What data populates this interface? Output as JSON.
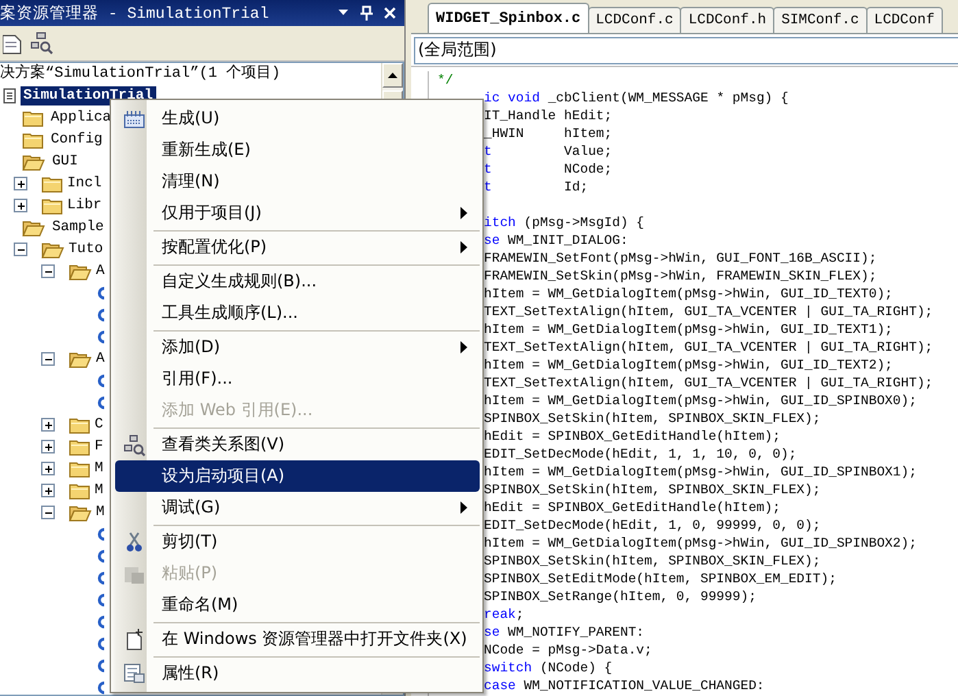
{
  "solution_explorer": {
    "title": "案资源管理器 - SimulationTrial",
    "solution_label": "决方案“SimulationTrial”(1 个项目)",
    "tree": [
      {
        "label": "SimulationTrial",
        "kind": "project",
        "selected": true,
        "children": [
          {
            "label": "Applica",
            "kind": "folder",
            "selected": false
          },
          {
            "label": "Config",
            "kind": "folder",
            "selected": false
          },
          {
            "label": "GUI",
            "kind": "folder",
            "selected": false,
            "expanded": true,
            "children": [
              {
                "label": "Incl",
                "kind": "folder",
                "selected": false,
                "expanded": false
              },
              {
                "label": "Libr",
                "kind": "folder",
                "selected": false,
                "expanded": false
              }
            ]
          },
          {
            "label": "Sample",
            "kind": "folder",
            "selected": false,
            "expanded": true,
            "children": [
              {
                "label": "Tuto",
                "kind": "folder",
                "selected": false,
                "expanded": true,
                "children": [
                  {
                    "label": "A",
                    "kind": "folder",
                    "selected": false,
                    "expanded": true,
                    "children": [
                      {
                        "kind": "file"
                      },
                      {
                        "kind": "file"
                      },
                      {
                        "kind": "file"
                      }
                    ]
                  },
                  {
                    "label": "A",
                    "kind": "folder",
                    "selected": false,
                    "expanded": true,
                    "children": [
                      {
                        "kind": "file"
                      },
                      {
                        "kind": "file"
                      }
                    ]
                  },
                  {
                    "label": "C",
                    "kind": "folder",
                    "selected": false,
                    "expanded": false
                  },
                  {
                    "label": "F",
                    "kind": "folder",
                    "selected": false,
                    "expanded": false
                  },
                  {
                    "label": "M",
                    "kind": "folder",
                    "selected": false,
                    "expanded": false
                  },
                  {
                    "label": "M",
                    "kind": "folder",
                    "selected": false,
                    "expanded": false
                  },
                  {
                    "label": "M",
                    "kind": "folder",
                    "selected": false,
                    "expanded": true,
                    "children": [
                      {
                        "kind": "file"
                      },
                      {
                        "kind": "file"
                      },
                      {
                        "kind": "file"
                      },
                      {
                        "kind": "file"
                      },
                      {
                        "kind": "file"
                      },
                      {
                        "kind": "file"
                      },
                      {
                        "kind": "file"
                      },
                      {
                        "kind": "file"
                      }
                    ]
                  }
                ]
              }
            ]
          }
        ]
      }
    ]
  },
  "editor": {
    "tabs": [
      {
        "label": "WIDGET_Spinbox.c",
        "selected": true
      },
      {
        "label": "LCDConf.c",
        "selected": false
      },
      {
        "label": "LCDConf.h",
        "selected": false
      },
      {
        "label": "SIMConf.c",
        "selected": false
      },
      {
        "label": "LCDConf",
        "selected": false
      }
    ],
    "scope": "(全局范围)",
    "lines": [
      {
        "kind": "comment",
        "text": "*/"
      },
      {
        "kind": "code",
        "kw": "ic void",
        "text": " _cbClient(WM_MESSAGE * pMsg) {"
      },
      {
        "kind": "code",
        "text": "IT_Handle hEdit;"
      },
      {
        "kind": "code",
        "text": "_HWIN     hItem;"
      },
      {
        "kind": "code",
        "kw": "t",
        "text": "         Value;"
      },
      {
        "kind": "code",
        "kw": "t",
        "text": "         NCode;"
      },
      {
        "kind": "code",
        "kw": "t",
        "text": "         Id;"
      },
      {
        "kind": "blank"
      },
      {
        "kind": "code",
        "kw": "itch",
        "text": " (pMsg->MsgId) {"
      },
      {
        "kind": "code",
        "kw": "se",
        "text": " WM_INIT_DIALOG:"
      },
      {
        "kind": "code",
        "text": "FRAMEWIN_SetFont(pMsg->hWin, GUI_FONT_16B_ASCII);"
      },
      {
        "kind": "code",
        "text": "FRAMEWIN_SetSkin(pMsg->hWin, FRAMEWIN_SKIN_FLEX);"
      },
      {
        "kind": "code",
        "text": "hItem = WM_GetDialogItem(pMsg->hWin, GUI_ID_TEXT0);"
      },
      {
        "kind": "code",
        "text": "TEXT_SetTextAlign(hItem, GUI_TA_VCENTER | GUI_TA_RIGHT);"
      },
      {
        "kind": "code",
        "text": "hItem = WM_GetDialogItem(pMsg->hWin, GUI_ID_TEXT1);"
      },
      {
        "kind": "code",
        "text": "TEXT_SetTextAlign(hItem, GUI_TA_VCENTER | GUI_TA_RIGHT);"
      },
      {
        "kind": "code",
        "text": "hItem = WM_GetDialogItem(pMsg->hWin, GUI_ID_TEXT2);"
      },
      {
        "kind": "code",
        "text": "TEXT_SetTextAlign(hItem, GUI_TA_VCENTER | GUI_TA_RIGHT);"
      },
      {
        "kind": "code",
        "text": "hItem = WM_GetDialogItem(pMsg->hWin, GUI_ID_SPINBOX0);"
      },
      {
        "kind": "code",
        "text": "SPINBOX_SetSkin(hItem, SPINBOX_SKIN_FLEX);"
      },
      {
        "kind": "code",
        "text": "hEdit = SPINBOX_GetEditHandle(hItem);"
      },
      {
        "kind": "code",
        "text": "EDIT_SetDecMode(hEdit, 1, 1, 10, 0, 0);"
      },
      {
        "kind": "code",
        "text": "hItem = WM_GetDialogItem(pMsg->hWin, GUI_ID_SPINBOX1);"
      },
      {
        "kind": "code",
        "text": "SPINBOX_SetSkin(hItem, SPINBOX_SKIN_FLEX);"
      },
      {
        "kind": "code",
        "text": "hEdit = SPINBOX_GetEditHandle(hItem);"
      },
      {
        "kind": "code",
        "text": "EDIT_SetDecMode(hEdit, 1, 0, 99999, 0, 0);"
      },
      {
        "kind": "code",
        "text": "hItem = WM_GetDialogItem(pMsg->hWin, GUI_ID_SPINBOX2);"
      },
      {
        "kind": "code",
        "text": "SPINBOX_SetSkin(hItem, SPINBOX_SKIN_FLEX);"
      },
      {
        "kind": "code",
        "text": "SPINBOX_SetEditMode(hItem, SPINBOX_EM_EDIT);"
      },
      {
        "kind": "code",
        "text": "SPINBOX_SetRange(hItem, 0, 99999);"
      },
      {
        "kind": "code",
        "kw": "reak",
        "text": ";"
      },
      {
        "kind": "code",
        "kw": "se",
        "text": " WM_NOTIFY_PARENT:"
      },
      {
        "kind": "code",
        "text": "NCode = pMsg->Data.v;"
      },
      {
        "kind": "code",
        "kw": "switch",
        "text": " (NCode) {"
      },
      {
        "kind": "code",
        "kw": "case",
        "text": " WM_NOTIFICATION_VALUE_CHANGED:"
      }
    ]
  },
  "menu": {
    "items": [
      {
        "kind": "build",
        "label": "生成(U)",
        "submenu": false,
        "disabled": false,
        "selected": false
      },
      {
        "kind": "plain",
        "label": "重新生成(E)",
        "submenu": false,
        "disabled": false,
        "selected": false
      },
      {
        "kind": "plain",
        "label": "清理(N)",
        "submenu": false,
        "disabled": false,
        "selected": false
      },
      {
        "kind": "plain",
        "label": "仅用于项目(J)",
        "submenu": true,
        "disabled": false,
        "selected": false
      },
      {
        "kind": "separator"
      },
      {
        "kind": "plain",
        "label": "按配置优化(P)",
        "submenu": true,
        "disabled": false,
        "selected": false
      },
      {
        "kind": "separator"
      },
      {
        "kind": "plain",
        "label": "自定义生成规则(B)...",
        "submenu": false,
        "disabled": false,
        "selected": false
      },
      {
        "kind": "plain",
        "label": "工具生成顺序(L)...",
        "submenu": false,
        "disabled": false,
        "selected": false
      },
      {
        "kind": "separator"
      },
      {
        "kind": "plain",
        "label": "添加(D)",
        "submenu": true,
        "disabled": false,
        "selected": false
      },
      {
        "kind": "plain",
        "label": "引用(F)...",
        "submenu": false,
        "disabled": false,
        "selected": false
      },
      {
        "kind": "plain",
        "label": "添加 Web 引用(E)...",
        "submenu": false,
        "disabled": true,
        "selected": false
      },
      {
        "kind": "separator"
      },
      {
        "kind": "diagram",
        "label": "查看类关系图(V)",
        "submenu": false,
        "disabled": false,
        "selected": false
      },
      {
        "kind": "plain",
        "label": "设为启动项目(A)",
        "submenu": false,
        "disabled": false,
        "selected": true
      },
      {
        "kind": "plain",
        "label": "调试(G)",
        "submenu": true,
        "disabled": false,
        "selected": false
      },
      {
        "kind": "separator"
      },
      {
        "kind": "cut",
        "label": "剪切(T)",
        "submenu": false,
        "disabled": false,
        "selected": false
      },
      {
        "kind": "paste",
        "label": "粘贴(P)",
        "submenu": false,
        "disabled": true,
        "selected": false
      },
      {
        "kind": "plain",
        "label": "重命名(M)",
        "submenu": false,
        "disabled": false,
        "selected": false
      },
      {
        "kind": "separator"
      },
      {
        "kind": "open",
        "label": "在 Windows 资源管理器中打开文件夹(X)",
        "submenu": false,
        "disabled": false,
        "selected": false
      },
      {
        "kind": "separator"
      },
      {
        "kind": "properties",
        "label": "属性(R)",
        "submenu": false,
        "disabled": false,
        "selected": false
      }
    ]
  }
}
